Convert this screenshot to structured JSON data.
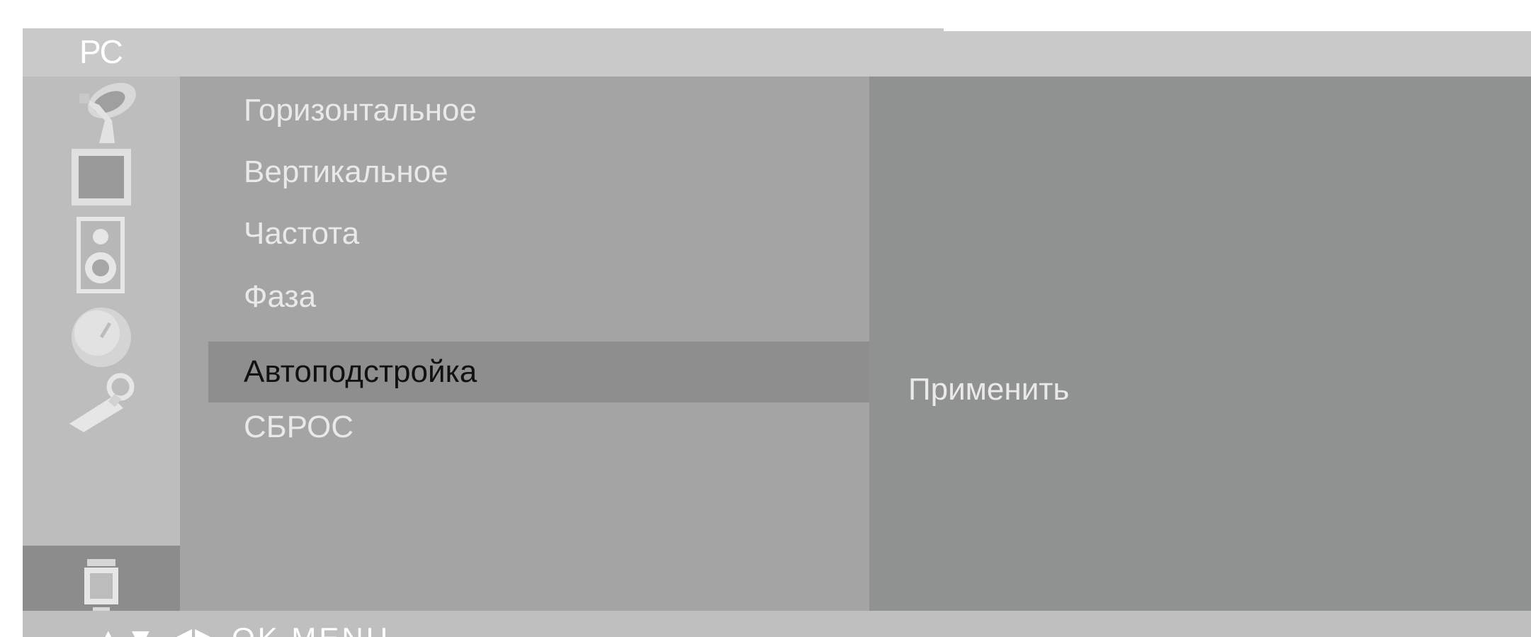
{
  "osd": {
    "title": "PC",
    "menu_items": [
      {
        "label": "Горизонтальное",
        "selected": false
      },
      {
        "label": "Вертикальное",
        "selected": false
      },
      {
        "label": "Частота",
        "selected": false
      },
      {
        "label": "Фаза",
        "selected": false
      },
      {
        "label": "Автоподстройка",
        "selected": true
      },
      {
        "label": "СБРОС",
        "selected": false
      }
    ],
    "value_label": "Применить",
    "footer_hint": "▲▼ ◀▶ OK MENU",
    "icons": [
      {
        "name": "satellite-dish-icon",
        "active": false
      },
      {
        "name": "picture-icon",
        "active": false
      },
      {
        "name": "speaker-icon",
        "active": false
      },
      {
        "name": "clock-icon",
        "active": false
      },
      {
        "name": "special-key-icon",
        "active": false
      },
      {
        "name": "pc-screen-icon",
        "active": true
      }
    ],
    "colors": {
      "background": "#a8a8a8",
      "title_bar": "#c9c9c9",
      "selected_row": "#8e8e8e",
      "right_panel": "#909291",
      "text_light": "#e9e9e9",
      "text_selected": "#111111"
    }
  }
}
